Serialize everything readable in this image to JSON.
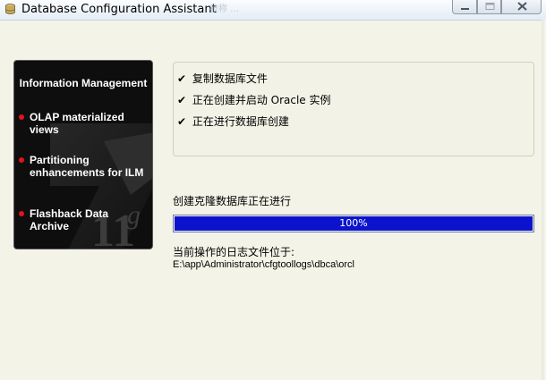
{
  "window": {
    "title": "Database Configuration Assistant",
    "faint_label": "被称 …",
    "icon": "dbca-app-icon"
  },
  "side_panel": {
    "heading": "Information Management",
    "items": [
      "OLAP materialized views",
      "Partitioning enhancements for ILM",
      "Flashback Data Archive"
    ],
    "watermark": "11g"
  },
  "steps": [
    {
      "check": "✔",
      "label": "复制数据库文件"
    },
    {
      "check": "✔",
      "label": "正在创建并启动 Oracle 实例"
    },
    {
      "check": "✔",
      "label": "正在进行数据库创建"
    }
  ],
  "progress": {
    "label": "创建克隆数据库正在进行",
    "value": 100,
    "text": "100%"
  },
  "log": {
    "label": "当前操作的日志文件位于:",
    "path": "E:\\app\\Administrator\\cfgtoollogs\\dbca\\orcl"
  },
  "colors": {
    "progress_fill": "#0b14cc",
    "bullet": "#e0141c",
    "panel_bg": "#0e0e0e"
  }
}
